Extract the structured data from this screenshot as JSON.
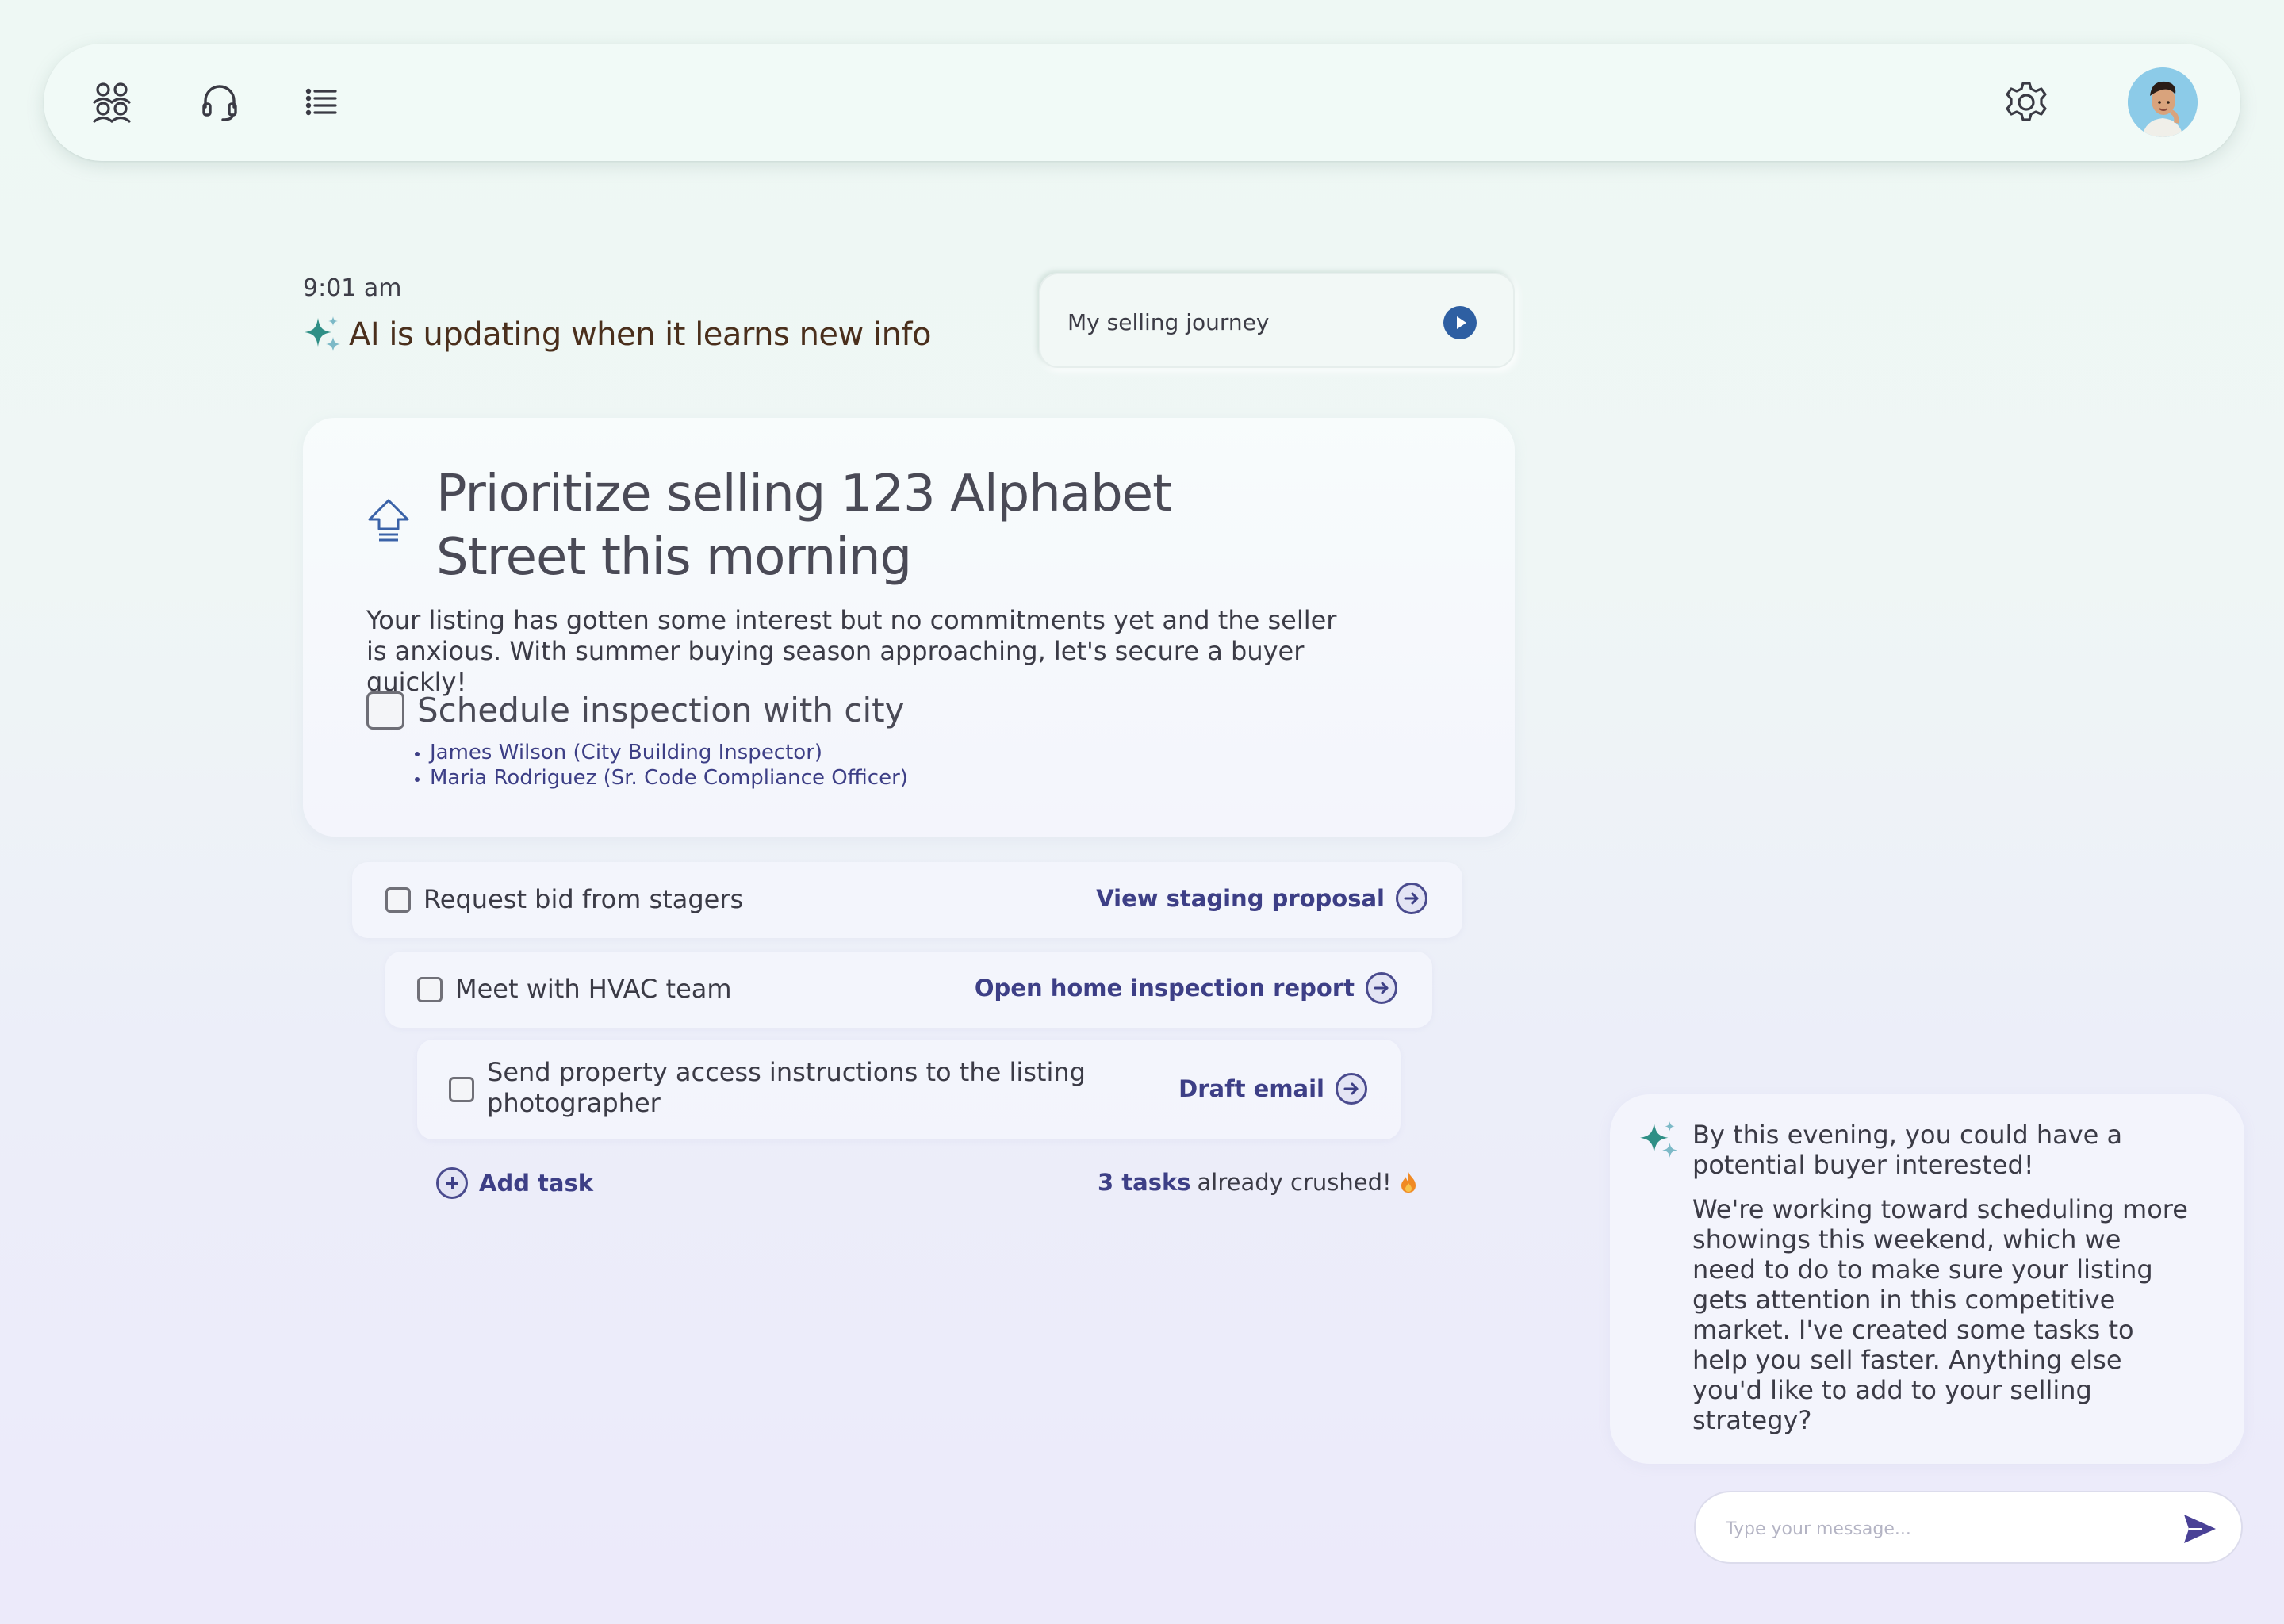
{
  "header": {
    "time": "9:01 am",
    "ai_status": "AI is updating when it learns new info",
    "journey_label": "My selling journey"
  },
  "icons": {
    "topbar_left": [
      "people-icon",
      "headset-icon",
      "list-icon"
    ],
    "topbar_right": [
      "gear-icon",
      "avatar"
    ]
  },
  "main_card": {
    "title": "Prioritize selling 123 Alphabet Street this morning",
    "description": "Your listing has gotten some interest but no commitments yet and the seller is anxious. With summer buying season approaching, let's secure a buyer quickly!",
    "task_label": "Schedule inspection with city",
    "task_checked": false,
    "contacts": [
      "James Wilson (City Building Inspector)",
      "Maria Rodriguez (Sr. Code Compliance Officer)"
    ]
  },
  "tasks": [
    {
      "label": "Request bid from stagers",
      "action": "View staging proposal",
      "checked": false
    },
    {
      "label": "Meet with HVAC team",
      "action": "Open home inspection report",
      "checked": false
    },
    {
      "label": "Send property access instructions to the listing photographer",
      "action": "Draft email",
      "checked": false
    }
  ],
  "footer": {
    "add_task": "Add task",
    "crushed_count": "3 tasks",
    "crushed_suffix": "already crushed!"
  },
  "chat": {
    "headline": "By this evening, you could have a potential buyer interested!",
    "body": "We're working toward scheduling more showings this weekend, which we need to do to make sure your listing gets attention in this competitive market. I've created some tasks to help you sell faster. Anything else you'd like to add to your selling strategy?",
    "input_placeholder": "Type your message...",
    "input_value": ""
  },
  "colors": {
    "accent": "#3d3f86",
    "journey_button": "#2e5fa2",
    "sparkle_teal": "#2f8f86",
    "status_text": "#4a2f1c"
  }
}
